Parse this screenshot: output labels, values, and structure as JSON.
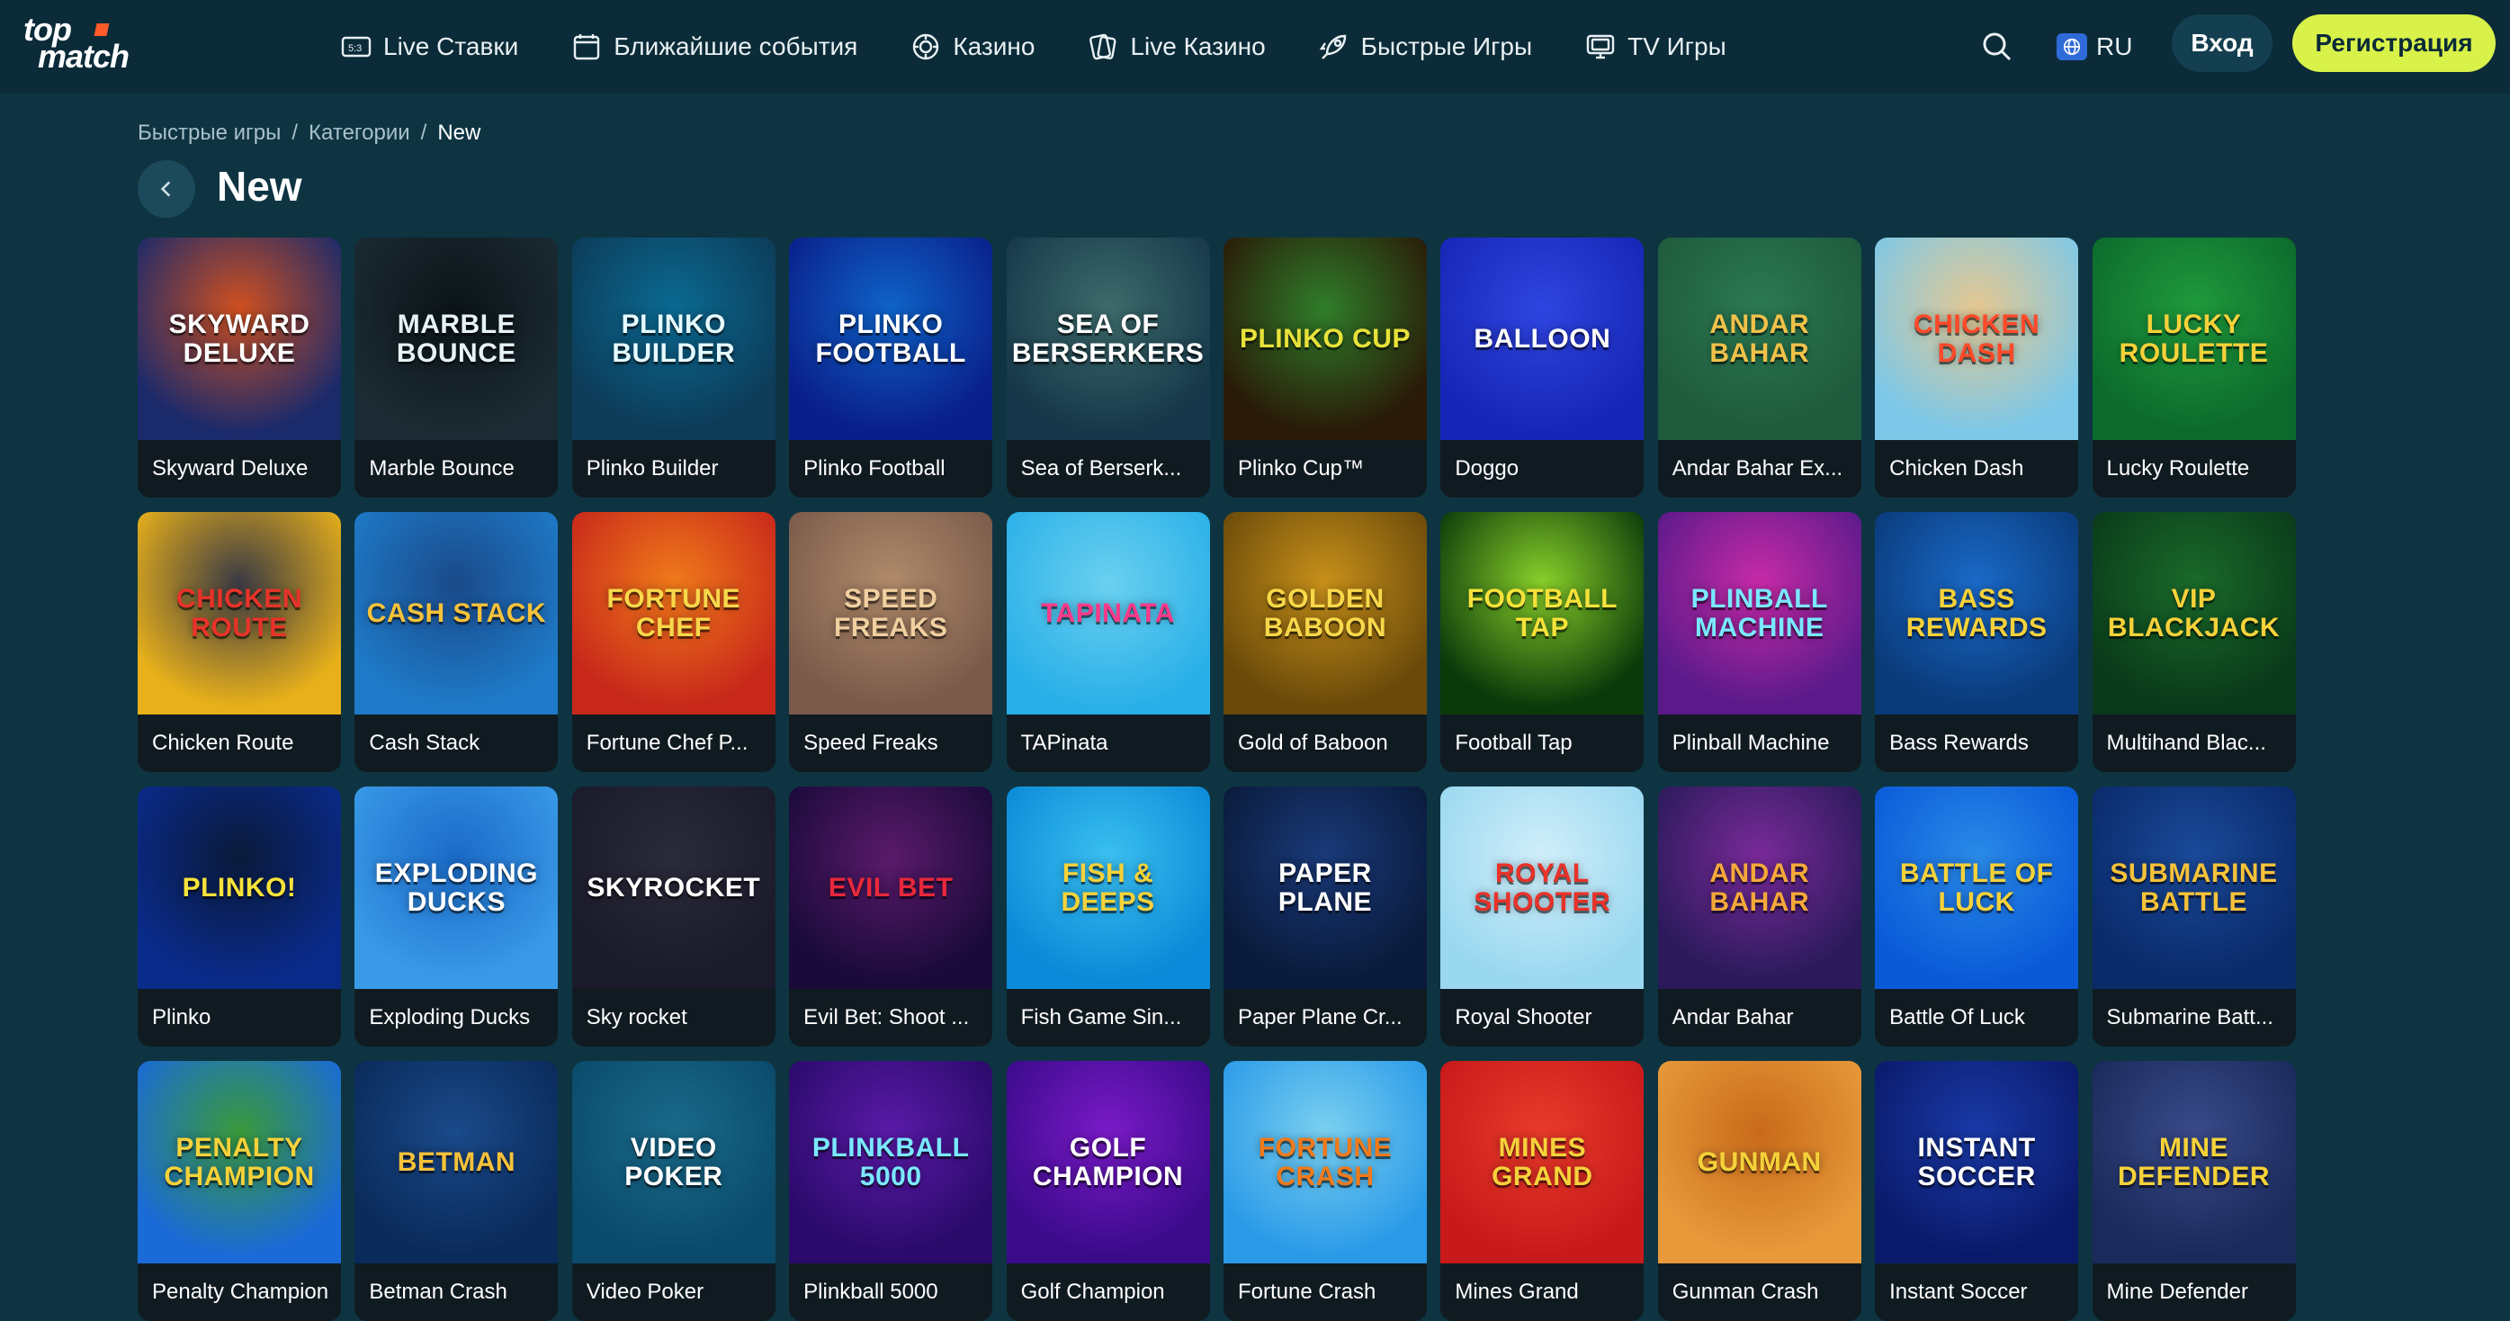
{
  "header": {
    "logo_top": "top",
    "logo_bottom": "match",
    "nav": [
      {
        "label": "Live Ставки",
        "icon": "live-bets-icon"
      },
      {
        "label": "Ближайшие события",
        "icon": "calendar-icon"
      },
      {
        "label": "Казино",
        "icon": "casino-chip-icon"
      },
      {
        "label": "Live Казино",
        "icon": "live-casino-icon"
      },
      {
        "label": "Быстрые Игры",
        "icon": "rocket-icon"
      },
      {
        "label": "TV Игры",
        "icon": "tv-icon"
      }
    ],
    "language": "RU",
    "login_label": "Вход",
    "register_label": "Регистрация"
  },
  "breadcrumb": {
    "items": [
      "Быстрые игры",
      "Категории",
      "New"
    ],
    "separator": "/"
  },
  "page": {
    "title": "New"
  },
  "games": [
    {
      "label": "Skyward Deluxe",
      "art": "Skyward Deluxe",
      "bg": [
        "#1b2a6b",
        "#d0501f"
      ],
      "fg": "#ffffff"
    },
    {
      "label": "Marble Bounce",
      "art": "Marble Bounce",
      "bg": [
        "#1c2a33",
        "#0b1418"
      ],
      "fg": "#e6f3f6"
    },
    {
      "label": "Plinko Builder",
      "art": "Plinko Builder",
      "bg": [
        "#0d3b58",
        "#0a6a92"
      ],
      "fg": "#e6fbff"
    },
    {
      "label": "Plinko Football",
      "art": "Plinko Football",
      "bg": [
        "#0a1f8a",
        "#0e63c8"
      ],
      "fg": "#ffffff"
    },
    {
      "label": "Sea of Berserk...",
      "art": "Sea of Berserkers",
      "bg": [
        "#16384a",
        "#3d6b6b"
      ],
      "fg": "#ffffff"
    },
    {
      "label": "Plinko Cup™",
      "art": "Plinko Cup",
      "bg": [
        "#2a1a08",
        "#2f7d2a"
      ],
      "fg": "#e8e23a"
    },
    {
      "label": "Doggo",
      "art": "Balloon",
      "bg": [
        "#1626b6",
        "#2f45e0"
      ],
      "fg": "#ffffff"
    },
    {
      "label": "Andar Bahar Ex...",
      "art": "Andar Bahar",
      "bg": [
        "#1e5a3c",
        "#2c7a52"
      ],
      "fg": "#f0c24a"
    },
    {
      "label": "Chicken Dash",
      "art": "Chicken Dash",
      "bg": [
        "#7dc8e8",
        "#e6c890"
      ],
      "fg": "#ff4a2a"
    },
    {
      "label": "Lucky Roulette",
      "art": "Lucky Roulette",
      "bg": [
        "#0c6a2c",
        "#1f9a3c"
      ],
      "fg": "#f6d23a"
    },
    {
      "label": "Chicken Route",
      "art": "Chicken Route",
      "bg": [
        "#e8b01a",
        "#3a3a44"
      ],
      "fg": "#e8332a"
    },
    {
      "label": "Cash Stack",
      "art": "Cash Stack",
      "bg": [
        "#1e7ac8",
        "#1a4a8a"
      ],
      "fg": "#f6c23a"
    },
    {
      "label": "Fortune Chef P...",
      "art": "Fortune Chef",
      "bg": [
        "#c8281a",
        "#f07a1a"
      ],
      "fg": "#f8d84a"
    },
    {
      "label": "Speed Freaks",
      "art": "Speed Freaks",
      "bg": [
        "#7a5a4a",
        "#b08a6a"
      ],
      "fg": "#f0d0a0"
    },
    {
      "label": "TAPinata",
      "art": "Tapinata",
      "bg": [
        "#2ab0e8",
        "#6ad0f0"
      ],
      "fg": "#ff3a8a"
    },
    {
      "label": "Gold of Baboon",
      "art": "Golden Baboon",
      "bg": [
        "#6a4a0a",
        "#c8901a"
      ],
      "fg": "#f8d84a"
    },
    {
      "label": "Football Tap",
      "art": "Football Tap",
      "bg": [
        "#0a3a0a",
        "#8ad02a"
      ],
      "fg": "#f6e23a"
    },
    {
      "label": "Plinball Machine",
      "art": "Plinball Machine",
      "bg": [
        "#5a1a8a",
        "#c82aa8"
      ],
      "fg": "#7ae8ff"
    },
    {
      "label": "Bass Rewards",
      "art": "Bass Rewards",
      "bg": [
        "#0a3a7a",
        "#1a6ac8"
      ],
      "fg": "#f6d23a"
    },
    {
      "label": "Multihand Blac...",
      "art": "VIP Blackjack",
      "bg": [
        "#0a3a1a",
        "#1a6a2a"
      ],
      "fg": "#f6d23a"
    },
    {
      "label": "Plinko",
      "art": "Plinko!",
      "bg": [
        "#0a2a8a",
        "#0a1a3a"
      ],
      "fg": "#f6e23a"
    },
    {
      "label": "Exploding Ducks",
      "art": "Exploding Ducks",
      "bg": [
        "#3a9ae8",
        "#1a6ac8"
      ],
      "fg": "#ffffff"
    },
    {
      "label": "Sky rocket",
      "art": "Skyrocket",
      "bg": [
        "#1a1a2a",
        "#2a2a3a"
      ],
      "fg": "#ffffff"
    },
    {
      "label": "Evil Bet: Shoot ...",
      "art": "Evil Bet",
      "bg": [
        "#1a0a3a",
        "#5a1a6a"
      ],
      "fg": "#e8283a"
    },
    {
      "label": "Fish Game Sin...",
      "art": "Fish & Deeps",
      "bg": [
        "#0a8ad8",
        "#3ac0f0"
      ],
      "fg": "#f6d23a"
    },
    {
      "label": "Paper Plane Cr...",
      "art": "Paper Plane",
      "bg": [
        "#0a1a3a",
        "#1a3a7a"
      ],
      "fg": "#ffffff"
    },
    {
      "label": "Royal Shooter",
      "art": "Royal Shooter",
      "bg": [
        "#9ad8f0",
        "#d0eefa"
      ],
      "fg": "#e8322a"
    },
    {
      "label": "Andar Bahar",
      "art": "Andar Bahar",
      "bg": [
        "#2a1a5a",
        "#7a2a9a"
      ],
      "fg": "#f6a83a"
    },
    {
      "label": "Battle Of Luck",
      "art": "Battle of Luck",
      "bg": [
        "#0a5ad8",
        "#2a8ae8"
      ],
      "fg": "#f6d23a"
    },
    {
      "label": "Submarine Batt...",
      "art": "Submarine Battle",
      "bg": [
        "#0a2a6a",
        "#1a4a9a"
      ],
      "fg": "#f6c23a"
    },
    {
      "label": "Penalty Champion",
      "art": "Penalty Champion",
      "bg": [
        "#1a6ad8",
        "#3a9a3a"
      ],
      "fg": "#f6d23a"
    },
    {
      "label": "Betman Crash",
      "art": "Betman",
      "bg": [
        "#0a2a5a",
        "#1a4a8a"
      ],
      "fg": "#f6c23a"
    },
    {
      "label": "Video Poker",
      "art": "Video Poker",
      "bg": [
        "#0a4a6a",
        "#1a6a8a"
      ],
      "fg": "#ffffff"
    },
    {
      "label": "Plinkball 5000",
      "art": "Plinkball 5000",
      "bg": [
        "#2a0a6a",
        "#5a1aa8"
      ],
      "fg": "#7ae8ff"
    },
    {
      "label": "Golf Champion",
      "art": "Golf Champion",
      "bg": [
        "#3a0a8a",
        "#7a1ac8"
      ],
      "fg": "#ffffff"
    },
    {
      "label": "Fortune Crash",
      "art": "Fortune Crash",
      "bg": [
        "#2a9ae8",
        "#7ad0f0"
      ],
      "fg": "#f07a1a"
    },
    {
      "label": "Mines Grand",
      "art": "Mines Grand",
      "bg": [
        "#c81a1a",
        "#e83a2a"
      ],
      "fg": "#f6d23a"
    },
    {
      "label": "Gunman Crash",
      "art": "Gunman",
      "bg": [
        "#e89a3a",
        "#c86a1a"
      ],
      "fg": "#f6d23a"
    },
    {
      "label": "Instant Soccer",
      "art": "Instant Soccer",
      "bg": [
        "#0a1a6a",
        "#1a3aa8"
      ],
      "fg": "#ffffff"
    },
    {
      "label": "Mine Defender",
      "art": "Mine Defender",
      "bg": [
        "#1a2a5a",
        "#3a4a8a"
      ],
      "fg": "#f6d23a"
    }
  ]
}
